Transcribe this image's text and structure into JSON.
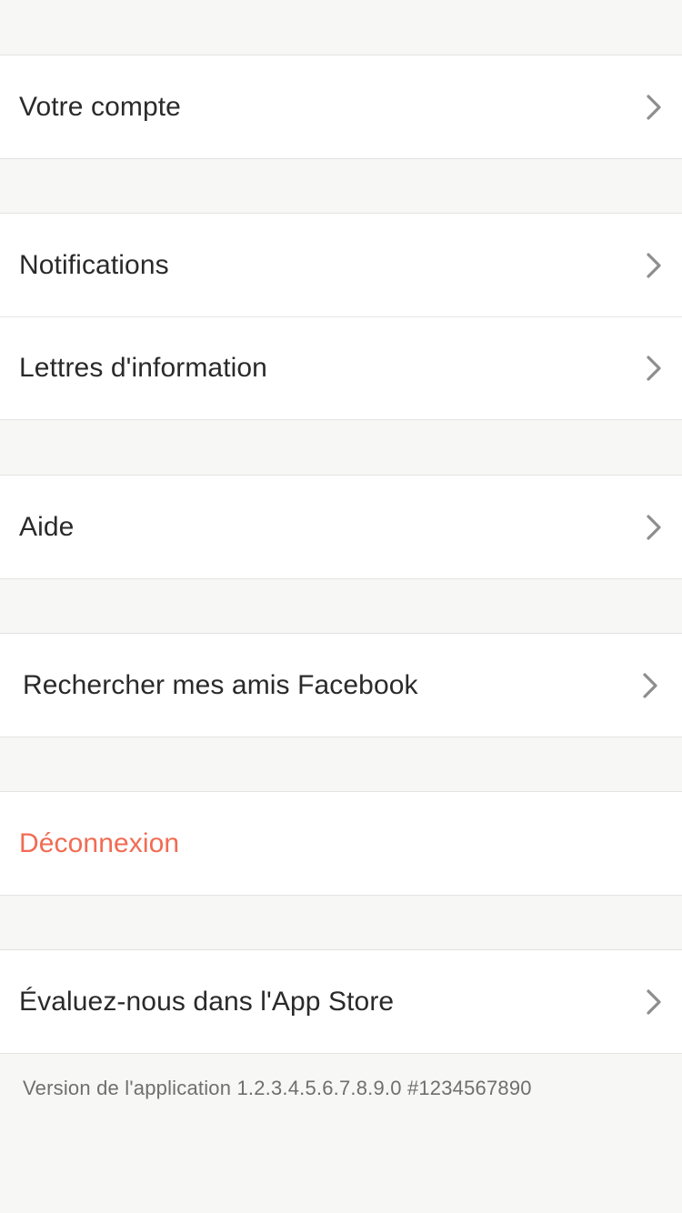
{
  "settings": {
    "account": {
      "label": "Votre compte",
      "icon": "chevron-right-icon"
    },
    "notifications": {
      "label": "Notifications",
      "icon": "chevron-right-icon"
    },
    "newsletters": {
      "label": "Lettres d'information",
      "icon": "chevron-right-icon"
    },
    "help": {
      "label": "Aide",
      "icon": "chevron-right-icon"
    },
    "facebook_friends": {
      "label": "Rechercher mes amis Facebook",
      "icon": "chevron-right-icon"
    },
    "logout": {
      "label": "Déconnexion",
      "color": "#f26b52"
    },
    "rate_app": {
      "label": "Évaluez-nous dans l'App Store",
      "icon": "chevron-right-icon"
    }
  },
  "footer": {
    "version": "Version de l'application 1.2.3.4.5.6.7.8.9.0 #1234567890"
  },
  "colors": {
    "background": "#f7f7f5",
    "surface": "#ffffff",
    "text": "#2a2a2a",
    "secondary_text": "#6f6f6f",
    "danger": "#f26b52",
    "chevron": "#8e8e8e",
    "separator": "#e3e3e1"
  }
}
